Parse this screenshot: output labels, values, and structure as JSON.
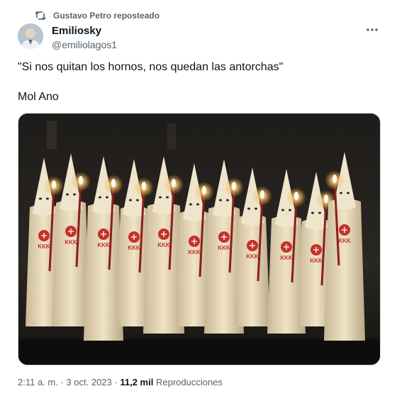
{
  "repost": {
    "label": "Gustavo Petro reposteado",
    "icon": "repost-icon"
  },
  "author": {
    "name": "Emiliosky",
    "handle": "@emiliolagos1",
    "avatar_icon": "avatar"
  },
  "more_icon": "more-icon",
  "tweet": {
    "line1": "\"Si nos quitan los hornos, nos quedan las antorchas\"",
    "line2": "Mol Ano"
  },
  "media": {
    "badge_text": "KKK"
  },
  "meta": {
    "time": "2:11 a. m.",
    "separator": "·",
    "date": "3 oct. 2023",
    "separator2": "·",
    "views": "11,2 mil",
    "views_label": "Reproducciones"
  },
  "colors": {
    "text": "#0f1419",
    "secondary": "#536471",
    "border": "#cfd9de"
  }
}
